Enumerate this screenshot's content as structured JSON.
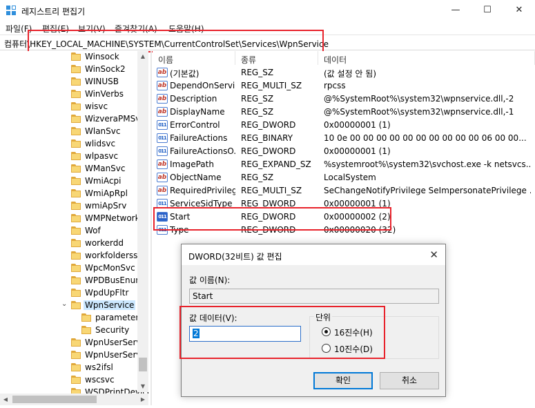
{
  "window": {
    "title": "레지스트리 편집기",
    "minimize_glyph": "—",
    "maximize_glyph": "☐",
    "close_glyph": "✕"
  },
  "menu": [
    "파일(F)",
    "편집(E)",
    "보기(V)",
    "즐겨찾기(A)",
    "도움말(H)"
  ],
  "address": {
    "path": "컴퓨터\\HKEY_LOCAL_MACHINE\\SYSTEM\\CurrentControlSet\\Services\\WpnService"
  },
  "tree": {
    "items": [
      {
        "label": "Winsock"
      },
      {
        "label": "WinSock2"
      },
      {
        "label": "WINUSB"
      },
      {
        "label": "WinVerbs"
      },
      {
        "label": "wisvc"
      },
      {
        "label": "WizveraPMSvc"
      },
      {
        "label": "WlanSvc"
      },
      {
        "label": "wlidsvc"
      },
      {
        "label": "wlpasvc"
      },
      {
        "label": "WManSvc"
      },
      {
        "label": "WmiAcpi"
      },
      {
        "label": "WmiApRpl"
      },
      {
        "label": "wmiApSrv"
      },
      {
        "label": "WMPNetworkSvc"
      },
      {
        "label": "Wof"
      },
      {
        "label": "workerdd"
      },
      {
        "label": "workfolderssvc"
      },
      {
        "label": "WpcMonSvc"
      },
      {
        "label": "WPDBusEnum"
      },
      {
        "label": "WpdUpFltr"
      },
      {
        "label": "WpnService",
        "expanded": true,
        "selected": true
      },
      {
        "label": "parameters",
        "child": true
      },
      {
        "label": "Security",
        "child": true
      },
      {
        "label": "WpnUserService"
      },
      {
        "label": "WpnUserService_"
      },
      {
        "label": "ws2ifsl"
      },
      {
        "label": "wscsvc"
      },
      {
        "label": "WSDPrintDevice"
      }
    ]
  },
  "values_pane": {
    "headers": {
      "name": "이름",
      "type": "종류",
      "data": "데이터"
    },
    "rows": [
      {
        "icon": "string-value-icon",
        "name": "(기본값)",
        "type": "REG_SZ",
        "data": "(값 설정 안 됨)"
      },
      {
        "icon": "string-value-icon",
        "name": "DependOnService",
        "type": "REG_MULTI_SZ",
        "data": "rpcss"
      },
      {
        "icon": "string-value-icon",
        "name": "Description",
        "type": "REG_SZ",
        "data": "@%SystemRoot%\\system32\\wpnservice.dll,-2"
      },
      {
        "icon": "string-value-icon",
        "name": "DisplayName",
        "type": "REG_SZ",
        "data": "@%SystemRoot%\\system32\\wpnservice.dll,-1"
      },
      {
        "icon": "binary-value-icon",
        "name": "ErrorControl",
        "type": "REG_DWORD",
        "data": "0x00000001 (1)"
      },
      {
        "icon": "binary-value-icon",
        "name": "FailureActions",
        "type": "REG_BINARY",
        "data": "10 0e 00 00 00 00 00 00 00 00 00 00 06 00 00..."
      },
      {
        "icon": "binary-value-icon",
        "name": "FailureActionsO...",
        "type": "REG_DWORD",
        "data": "0x00000001 (1)"
      },
      {
        "icon": "string-value-icon",
        "name": "ImagePath",
        "type": "REG_EXPAND_SZ",
        "data": "%systemroot%\\system32\\svchost.exe -k netsvcs..."
      },
      {
        "icon": "string-value-icon",
        "name": "ObjectName",
        "type": "REG_SZ",
        "data": "LocalSystem"
      },
      {
        "icon": "string-value-icon",
        "name": "RequiredPrivilege...",
        "type": "REG_MULTI_SZ",
        "data": "SeChangeNotifyPrivilege SeImpersonatePrivilege ..."
      },
      {
        "icon": "binary-value-icon",
        "name": "ServiceSidType",
        "type": "REG_DWORD",
        "data": "0x00000001 (1)"
      },
      {
        "icon": "binary-value-icon",
        "name": "Start",
        "type": "REG_DWORD",
        "data": "0x00000002 (2)",
        "selected": true
      },
      {
        "icon": "binary-value-icon",
        "name": "Type",
        "type": "REG_DWORD",
        "data": "0x00000020 (32)"
      }
    ]
  },
  "dialog": {
    "title": "DWORD(32비트) 값 편집",
    "close_glyph": "✕",
    "name_label": "값 이름(N):",
    "name_value": "Start",
    "data_label": "값 데이터(V):",
    "data_value": "2",
    "base_label": "단위",
    "hex_label": "16진수(H)",
    "dec_label": "10진수(D)",
    "selected_base": "hex",
    "ok_label": "확인",
    "cancel_label": "취소"
  },
  "colors": {
    "highlight_box": "#e8222b",
    "selection": "#cce8ff",
    "accent": "#0078d7"
  }
}
